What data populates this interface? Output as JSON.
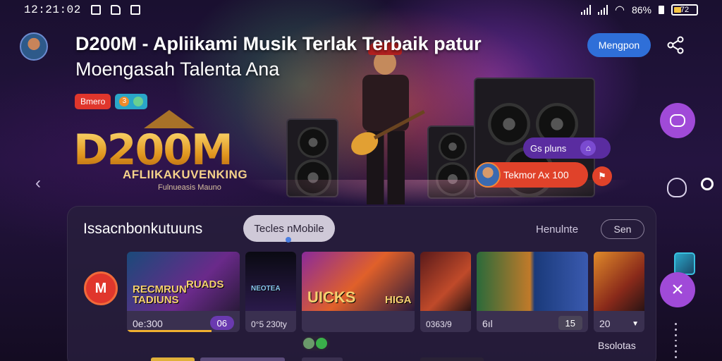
{
  "status": {
    "time": "12:21:02",
    "battery_text": "72",
    "signal_text": "86%"
  },
  "header": {
    "title_line1": "D200M - Apliikami Musik Terlak Terbaik patur",
    "title_line2": "Moengasah Talenta Ana",
    "manage_label": "Mengpon",
    "tags": [
      "Bmero",
      "3"
    ]
  },
  "hero": {
    "logo_text": "D200M",
    "logo_sub": "AFLIIKAKUVENKING",
    "logo_sub2": "Fulnueasis Mauno",
    "chip_purple": "Gs pluns",
    "chip_orange": "Tekmor Ax 100"
  },
  "panel": {
    "title": "Issacnbonkutuuns",
    "active_tab": "Tecles nMobile",
    "label": "Henulnte",
    "filter_button": "Sen",
    "badge_letter": "M",
    "footer_text": "Bsolotas",
    "cards": [
      {
        "caption": "RECMRUN TADIUNS",
        "caption2": "RUADS",
        "meta": "0e:300",
        "badge": "06",
        "progress": 0.75
      },
      {
        "caption": "NEOTEA",
        "caption2": "",
        "meta": "0°5 230ty",
        "badge": "",
        "progress": 0
      },
      {
        "caption": "UICKS",
        "caption2": "HIGA",
        "meta": "",
        "badge": "",
        "progress": 0
      },
      {
        "caption": "",
        "caption2": "",
        "meta": "0363/9",
        "badge": "",
        "progress": 0
      },
      {
        "caption": "",
        "caption2": "",
        "meta": "6ıl",
        "badge": "15",
        "progress": 0
      },
      {
        "caption": "",
        "caption2": "",
        "meta": "20",
        "badge": "",
        "progress": 0
      }
    ]
  },
  "colors": {
    "accent": "#a04ad8",
    "primary_button": "#2f6fd8",
    "red": "#e0362c"
  }
}
